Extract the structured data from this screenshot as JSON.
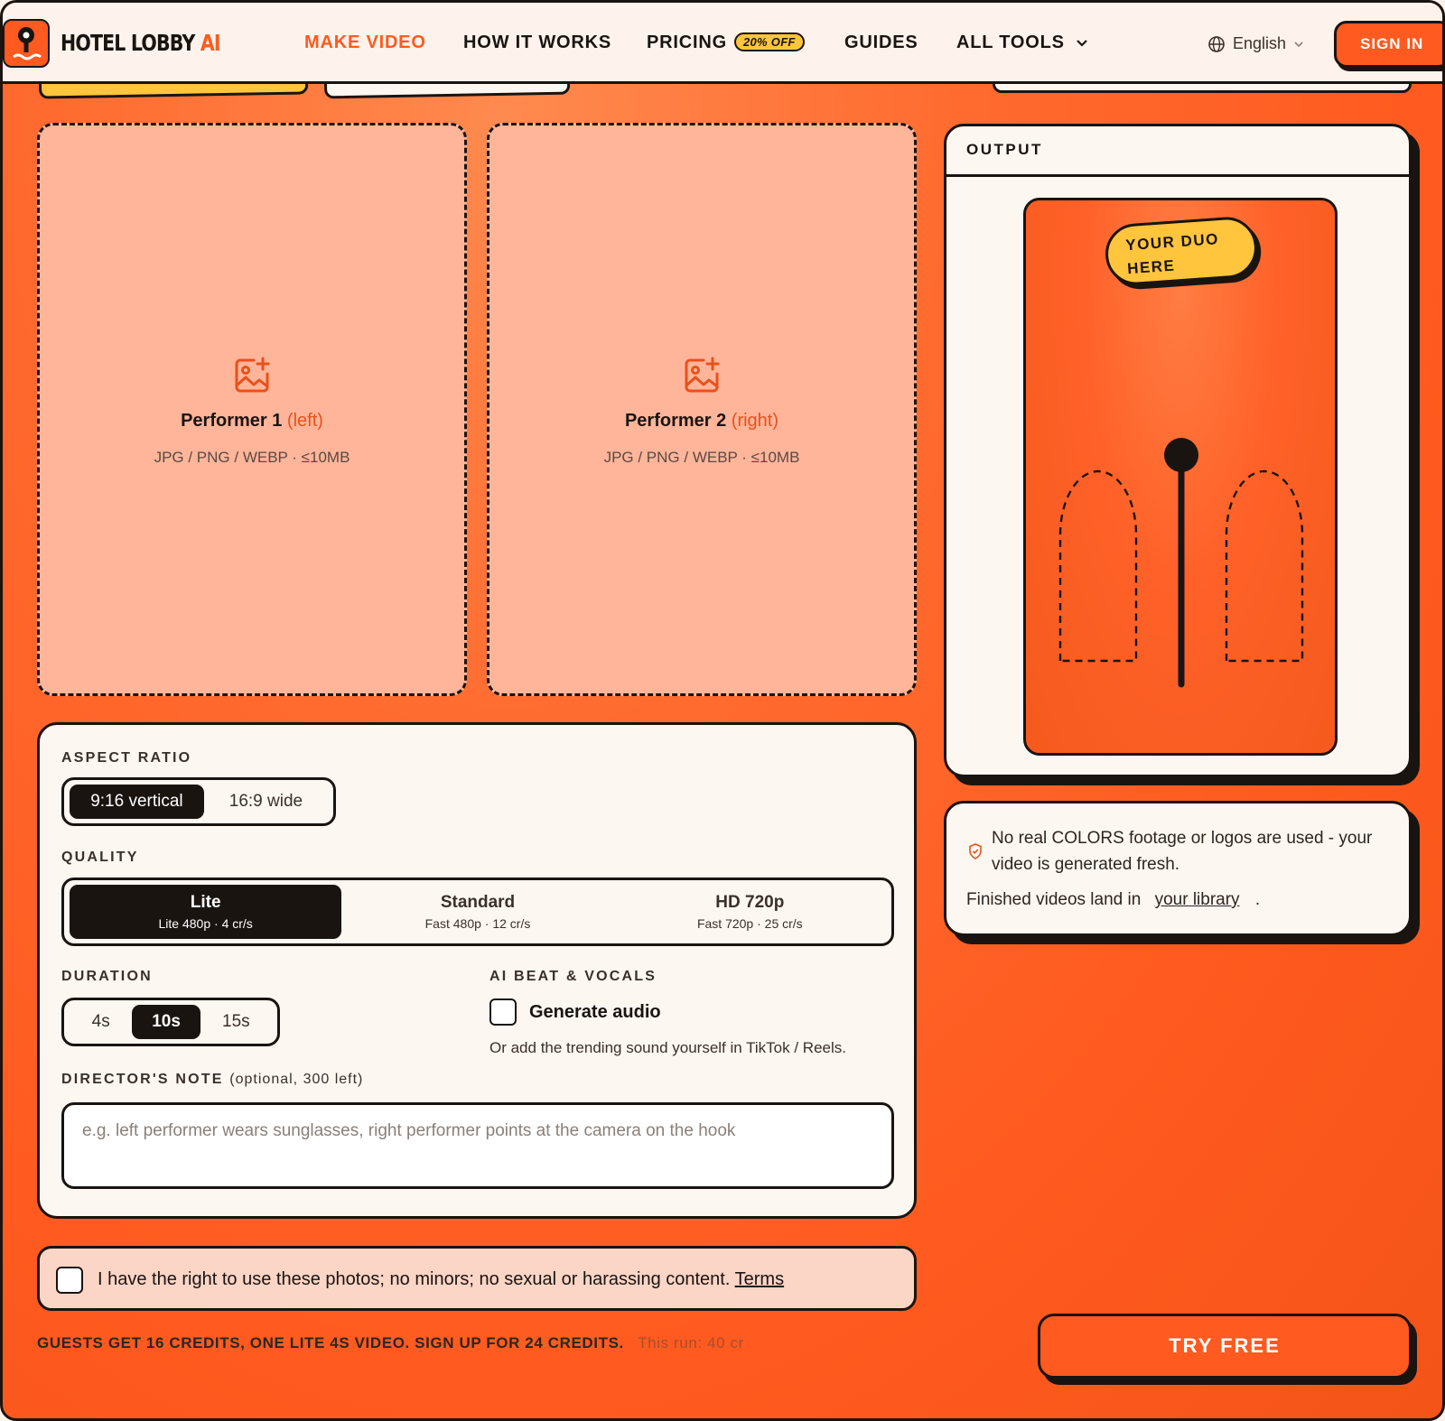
{
  "header": {
    "brand_main": "HOTEL LOBBY",
    "brand_accent": "AI",
    "nav": [
      {
        "label": "MAKE VIDEO"
      },
      {
        "label": "HOW IT WORKS"
      },
      {
        "label": "PRICING",
        "badge": "20% OFF"
      },
      {
        "label": "GUIDES"
      },
      {
        "label": "ALL TOOLS"
      }
    ],
    "language": "English",
    "sign_in": "SIGN IN"
  },
  "uploads": [
    {
      "title": "Performer 1",
      "side": "(left)",
      "formats": "JPG / PNG / WEBP · ≤10MB"
    },
    {
      "title": "Performer 2",
      "side": "(right)",
      "formats": "JPG / PNG / WEBP · ≤10MB"
    }
  ],
  "output": {
    "heading": "OUTPUT",
    "tag_line1": "YOUR DUO",
    "tag_line2": "HERE"
  },
  "info": {
    "disclaimer": "No real COLORS footage or logos are used - your video is generated fresh.",
    "library_prefix": "Finished videos land in",
    "library_link": "your library",
    "library_suffix": "."
  },
  "settings": {
    "aspect_label": "ASPECT RATIO",
    "aspect_options": [
      "9:16 vertical",
      "16:9 wide"
    ],
    "aspect_selected": "9:16 vertical",
    "quality_label": "QUALITY",
    "quality_options": [
      {
        "name": "Lite",
        "detail": "Lite 480p · 4 cr/s"
      },
      {
        "name": "Standard",
        "detail": "Fast 480p · 12 cr/s"
      },
      {
        "name": "HD 720p",
        "detail": "Fast 720p · 25 cr/s"
      }
    ],
    "quality_selected": "Lite",
    "duration_label": "DURATION",
    "duration_options": [
      "4s",
      "10s",
      "15s"
    ],
    "duration_selected": "10s",
    "audio_label": "AI BEAT & VOCALS",
    "audio_checkbox": "Generate audio",
    "audio_checked": false,
    "audio_hint": "Or add the trending sound yourself in TikTok / Reels.",
    "note_label": "DIRECTOR'S NOTE",
    "note_hint": "(optional, 300 left)",
    "note_placeholder": "e.g. left performer wears sunglasses, right performer points at the camera on the hook"
  },
  "consent": {
    "text": "I have the right to use these photos; no minors; no sexual or harassing content.",
    "link": "Terms",
    "checked": false
  },
  "footer": {
    "credits_note": "GUESTS GET 16 CREDITS, ONE LITE 4S VIDEO. SIGN UP FOR 24 CREDITS.",
    "run_cost": "This run: 40 cr",
    "cta": "TRY FREE"
  },
  "colors": {
    "accent": "#ff5a1f",
    "yellow": "#ffc53d",
    "ink": "#1a1411",
    "cream": "#fdf7f2",
    "upload_fill": "#ffb59a"
  }
}
